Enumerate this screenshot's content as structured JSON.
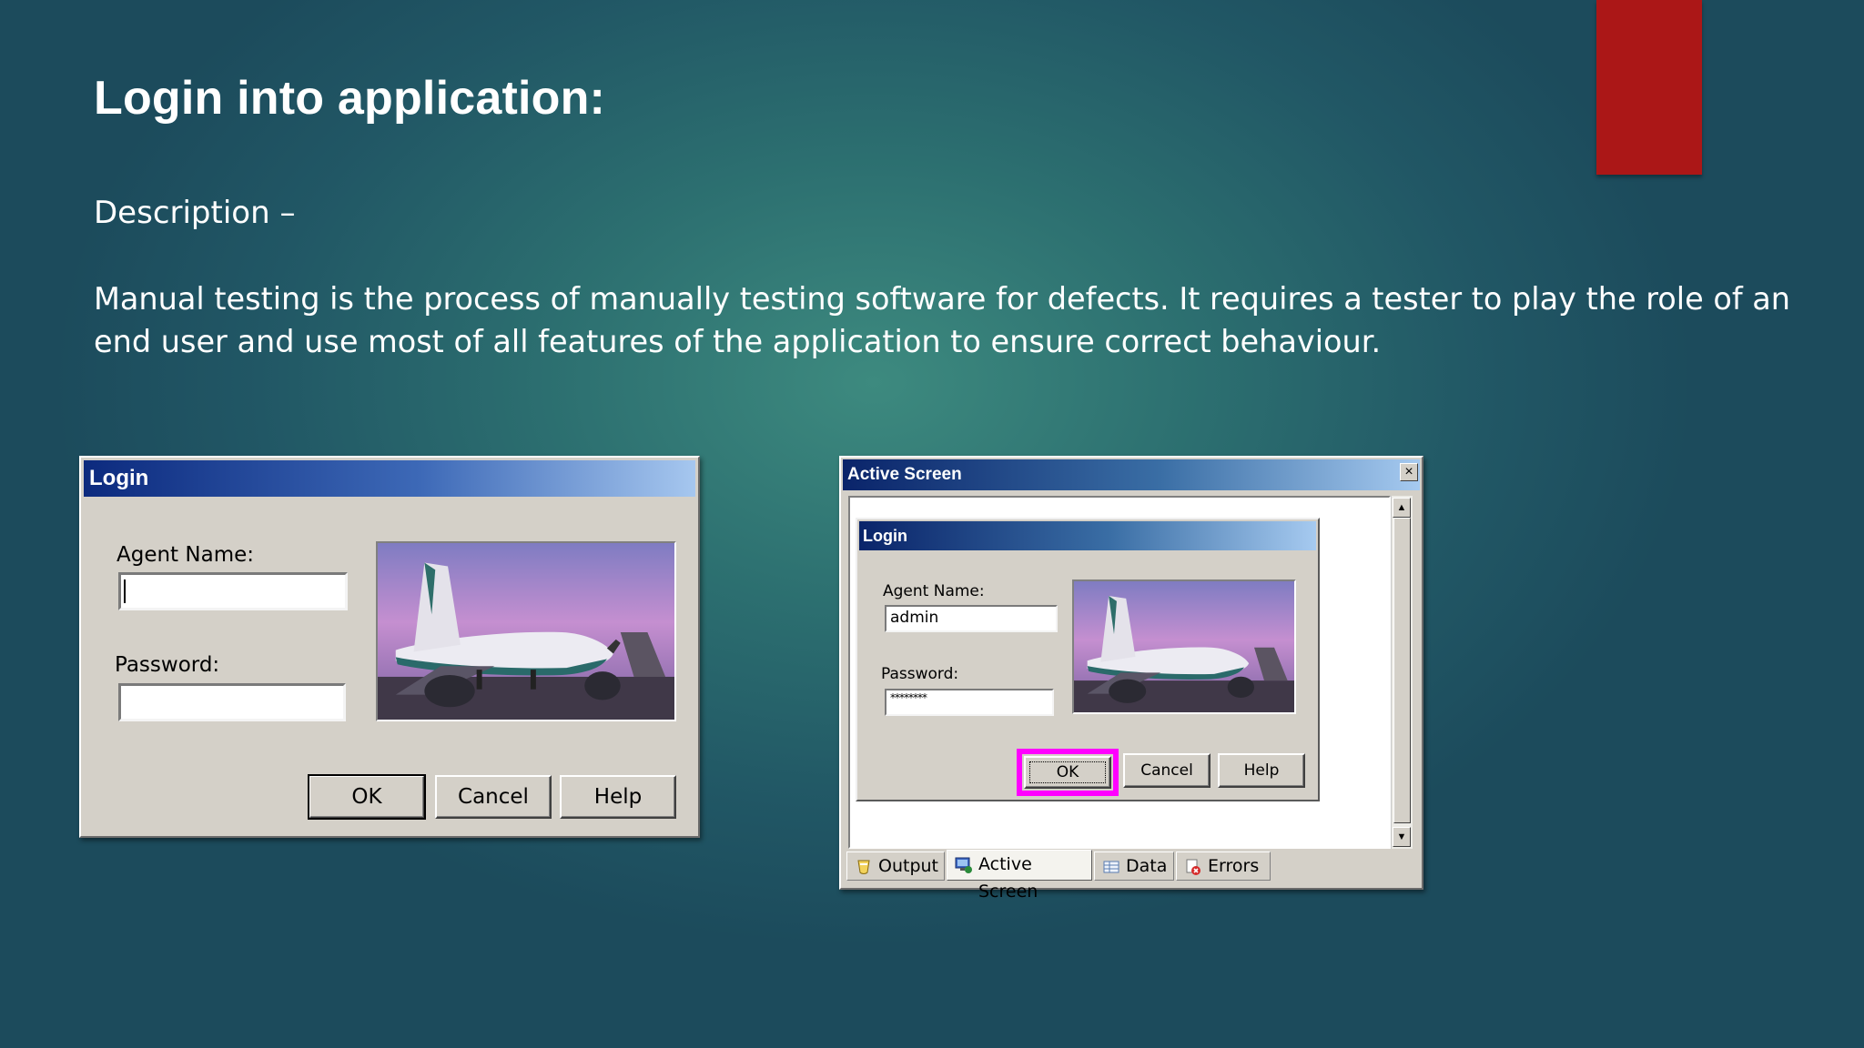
{
  "slide": {
    "title": "Login into application:",
    "description_heading": "Description –",
    "body_line1": "Manual testing is the process of manually testing software for defects. It requires a tester to play the role of an",
    "body_line2": "end user and use most of all features of the application to ensure correct behaviour.",
    "accent_color": "#ab1717"
  },
  "login_dialog": {
    "title": "Login",
    "agent_label": "Agent Name:",
    "agent_value": "",
    "password_label": "Password:",
    "password_value": "",
    "ok_label": "OK",
    "cancel_label": "Cancel",
    "help_label": "Help",
    "image_icon": "airplane-image"
  },
  "active_screen": {
    "title": "Active Screen",
    "close_glyph": "×",
    "login": {
      "title": "Login",
      "agent_label": "Agent Name:",
      "agent_value": "admin",
      "password_label": "Password:",
      "password_value": "********",
      "ok_label": "OK",
      "cancel_label": "Cancel",
      "help_label": "Help",
      "highlight_color": "#ff00ff"
    },
    "tabs": [
      {
        "label": "Output",
        "icon": "output-icon"
      },
      {
        "label": "Active Screen",
        "icon": "active-screen-icon"
      },
      {
        "label": "Data",
        "icon": "data-icon"
      },
      {
        "label": "Errors",
        "icon": "errors-icon"
      }
    ],
    "active_tab": "Active Screen"
  }
}
